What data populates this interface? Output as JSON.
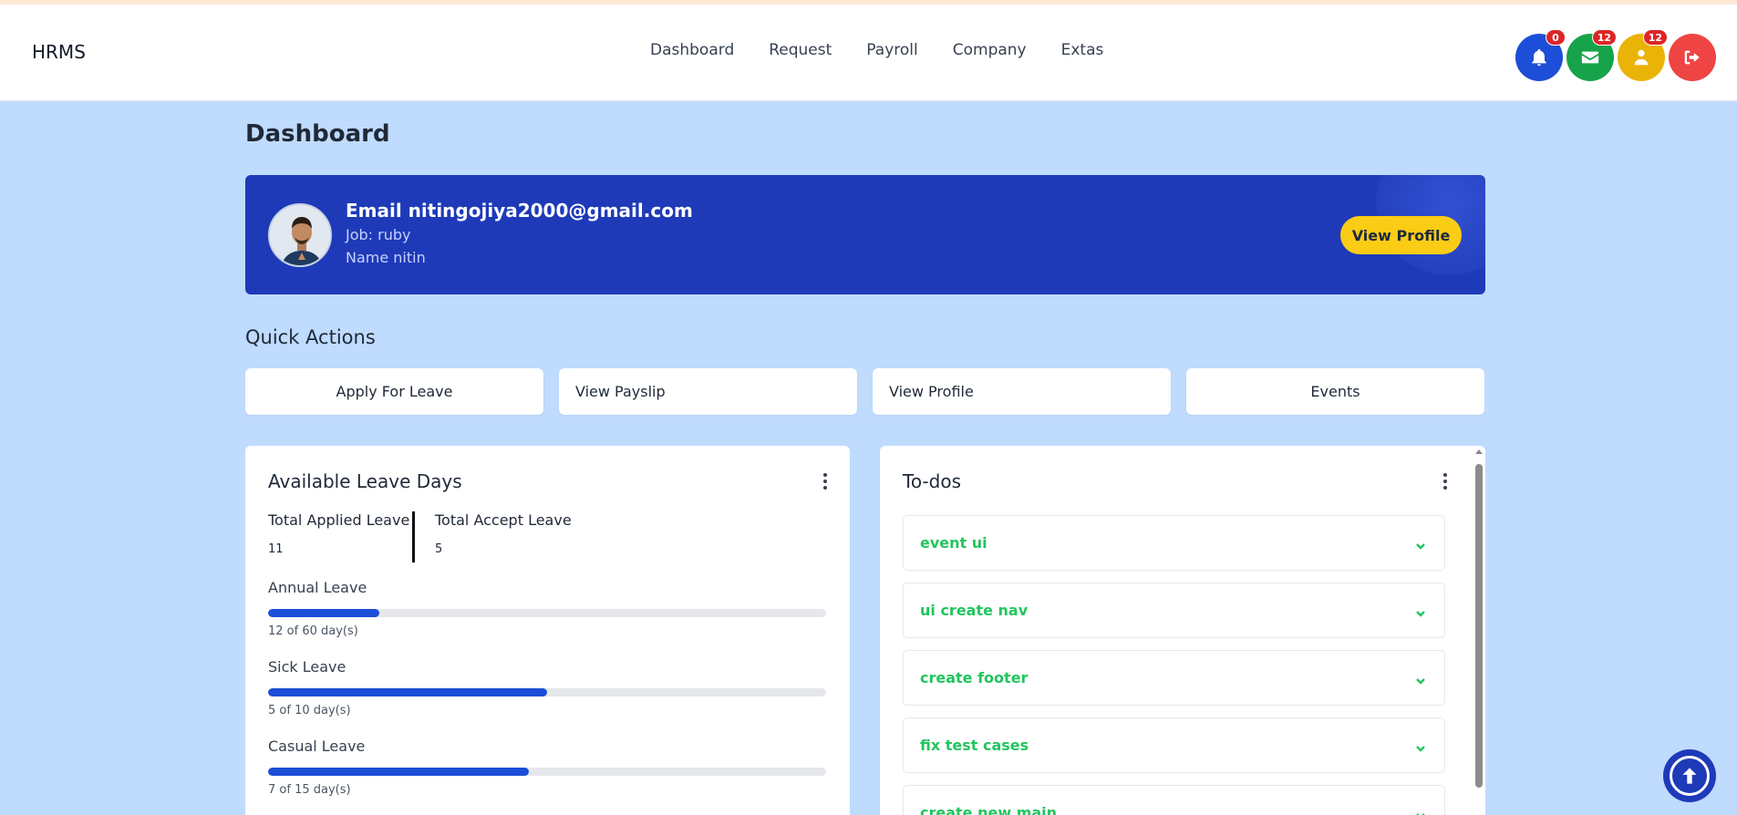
{
  "navbar": {
    "brand": "HRMS",
    "links": [
      "Dashboard",
      "Request",
      "Payroll",
      "Company",
      "Extas"
    ],
    "icons": [
      {
        "name": "bell-icon",
        "badge": "0",
        "color": "#1d4ed8"
      },
      {
        "name": "mail-icon",
        "badge": "12",
        "color": "#16a34a"
      },
      {
        "name": "user-icon",
        "badge": "12",
        "color": "#eab308"
      },
      {
        "name": "logout-icon",
        "badge": "",
        "color": "#ef4444"
      }
    ]
  },
  "page": {
    "title": "Dashboard"
  },
  "profile": {
    "email": "Email nitingojiya2000@gmail.com",
    "job": "Job: ruby",
    "name": "Name nitin",
    "view_profile_label": "View Profile"
  },
  "quick_actions": {
    "title": "Quick Actions",
    "items": [
      "Apply For Leave",
      "View Payslip",
      "View Profile",
      "Events"
    ]
  },
  "leave": {
    "title": "Available Leave Days",
    "total_applied_label": "Total Applied Leave",
    "total_applied_value": "11",
    "total_accept_label": "Total Accept Leave",
    "total_accept_value": "5",
    "types": [
      {
        "name": "Annual Leave",
        "caption": "12 of 60 day(s)",
        "used": 12,
        "total": 60
      },
      {
        "name": "Sick Leave",
        "caption": "5 of 10 day(s)",
        "used": 5,
        "total": 10
      },
      {
        "name": "Casual Leave",
        "caption": "7 of 15 day(s)",
        "used": 7,
        "total": 15
      }
    ]
  },
  "todos": {
    "title": "To-dos",
    "items": [
      "event ui",
      "ui create nav",
      "create footer",
      "fix test cases",
      "create new main"
    ]
  },
  "colors": {
    "background": "#bfdbfe",
    "profile_card": "#1e3ab8",
    "accent_yellow": "#facc15",
    "progress": "#1d4ed8",
    "todo_green": "#22c55e"
  }
}
